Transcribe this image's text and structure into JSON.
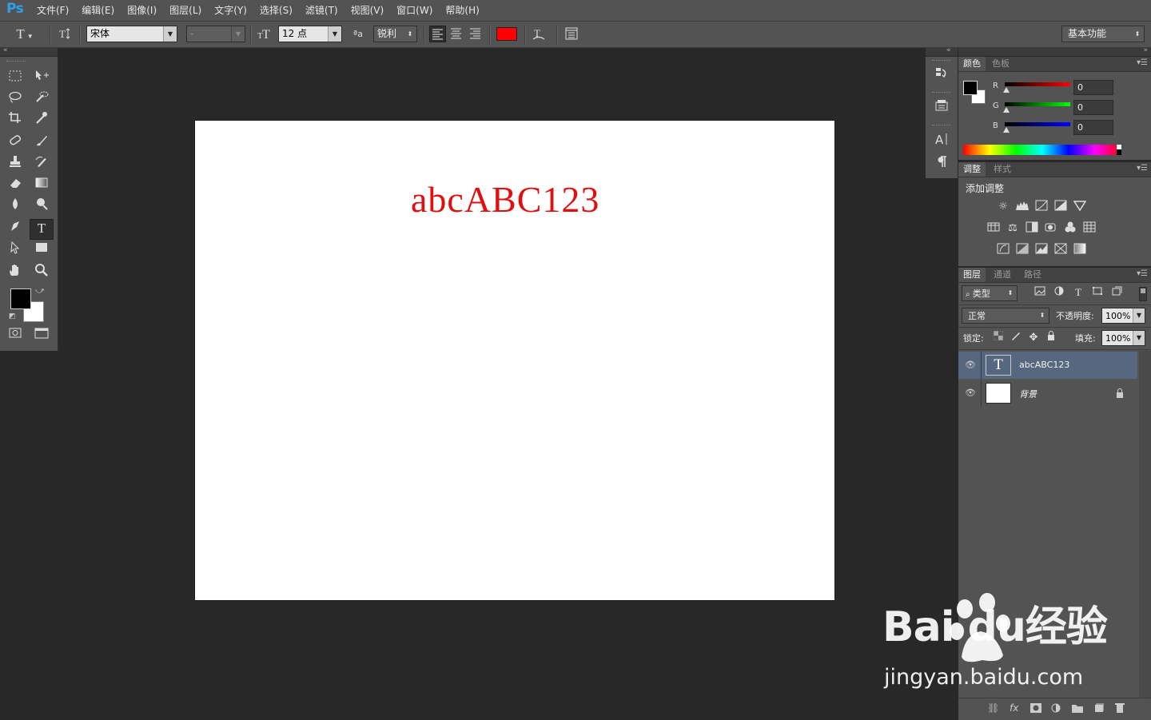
{
  "app": {
    "logo": "Ps",
    "menus": [
      "文件(F)",
      "编辑(E)",
      "图像(I)",
      "图层(L)",
      "文字(Y)",
      "选择(S)",
      "滤镜(T)",
      "视图(V)",
      "窗口(W)",
      "帮助(H)"
    ]
  },
  "options": {
    "tool_icon": "T",
    "font_family": "宋体",
    "font_style": "-",
    "font_size": "12 点",
    "aa_label": "ªa",
    "antialias": "锐利",
    "text_color": "#ff0000",
    "workspace": "基本功能"
  },
  "canvas": {
    "text": "abcABC123",
    "text_color": "#e01010"
  },
  "color_panel": {
    "tabs": [
      "颜色",
      "色板"
    ],
    "r_label": "R",
    "g_label": "G",
    "b_label": "B",
    "r_value": "0",
    "g_value": "0",
    "b_value": "0"
  },
  "adjust_panel": {
    "tabs": [
      "调整",
      "样式"
    ],
    "title": "添加调整"
  },
  "layers_panel": {
    "tabs": [
      "图层",
      "通道",
      "路径"
    ],
    "filter_kind": "类型",
    "blend_mode": "正常",
    "opacity_label": "不透明度:",
    "opacity_value": "100%",
    "lock_label": "锁定:",
    "fill_label": "填充:",
    "fill_value": "100%",
    "layers": [
      {
        "name": "abcABC123",
        "type": "text",
        "selected": true
      },
      {
        "name": "背景",
        "type": "background",
        "selected": false
      }
    ]
  },
  "watermark": {
    "line1": "Bai du经验",
    "line2": "jingyan.baidu.com"
  }
}
